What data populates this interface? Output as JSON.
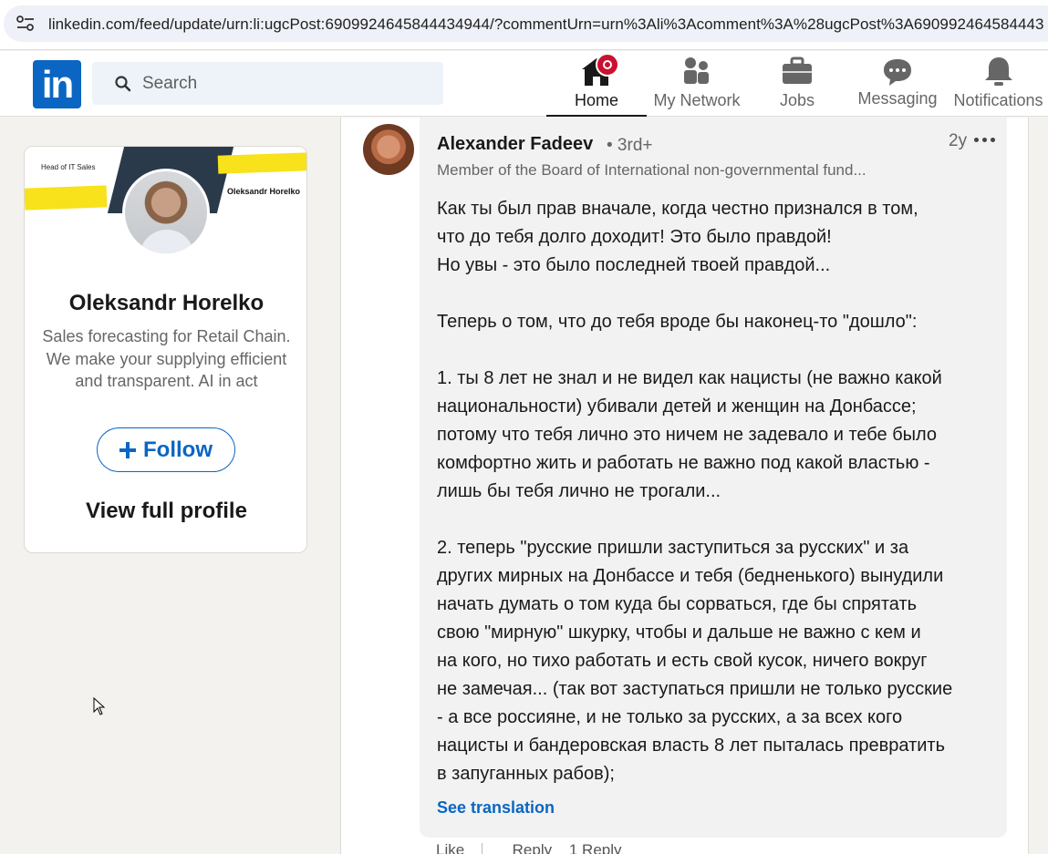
{
  "browser": {
    "url": "linkedin.com/feed/update/urn:li:ugcPost:6909924645844434944/?commentUrn=urn%3Ali%3Acomment%3A%28ugcPost%3A690992464584443"
  },
  "nav": {
    "logo": "in",
    "search_placeholder": "Search",
    "items": [
      {
        "label": "Home"
      },
      {
        "label": "My Network"
      },
      {
        "label": "Jobs"
      },
      {
        "label": "Messaging"
      },
      {
        "label": "Notifications"
      }
    ]
  },
  "profile": {
    "banner_small_text": "Head of IT Sales",
    "banner_name": "Oleksandr Horelko",
    "name": "Oleksandr Horelko",
    "headline": "Sales forecasting for Retail Chain. We make your supplying efficient and transparent. AI in act",
    "follow_label": "Follow",
    "view_profile_label": "View full profile"
  },
  "comment": {
    "author": "Alexander Fadeev",
    "degree": "• 3rd+",
    "time": "2y",
    "headline": "Member of the Board of International non-governmental fund...",
    "body": "Как ты был прав вначале, когда честно признался в том,\nчто до тебя долго доходит! Это было правдой!\nНо увы - это было последней твоей правдой...\n\nТеперь о том, что до тебя вроде бы наконец-то \"дошло\":\n\n1. ты 8 лет не знал и не видел как нацисты (не важно какой\nнациональности) убивали детей и женщин на Донбассе;\nпотому что тебя лично это ничем не задевало и тебе было\nкомфортно жить и работать не важно под какой властью -\nлишь бы тебя лично не трогали...\n\n2. теперь \"русские пришли заступиться за русских\" и за\nдругих мирных на Донбассе и тебя (бедненького) вынудили\nначать думать о том куда бы сорваться, где бы спрятать\nсвою \"мирную\" шкурку, чтобы и дальше не важно с кем и\nна кого, но тихо работать и есть свой кусок, ничего вокруг\nне замечая... (так вот заступаться пришли не только русские\n- а все россияне, и не только за русских, а за всех кого\nнацисты и бандеровская власть 8 лет пыталась превратить\nв запуганных рабов);",
    "see_translation": "See translation",
    "like": "Like",
    "reply": "Reply",
    "replies": "1 Reply"
  },
  "colors": {
    "brand": "#0a66c2",
    "badge": "#cb112d",
    "page_bg": "#f4f2ee"
  }
}
